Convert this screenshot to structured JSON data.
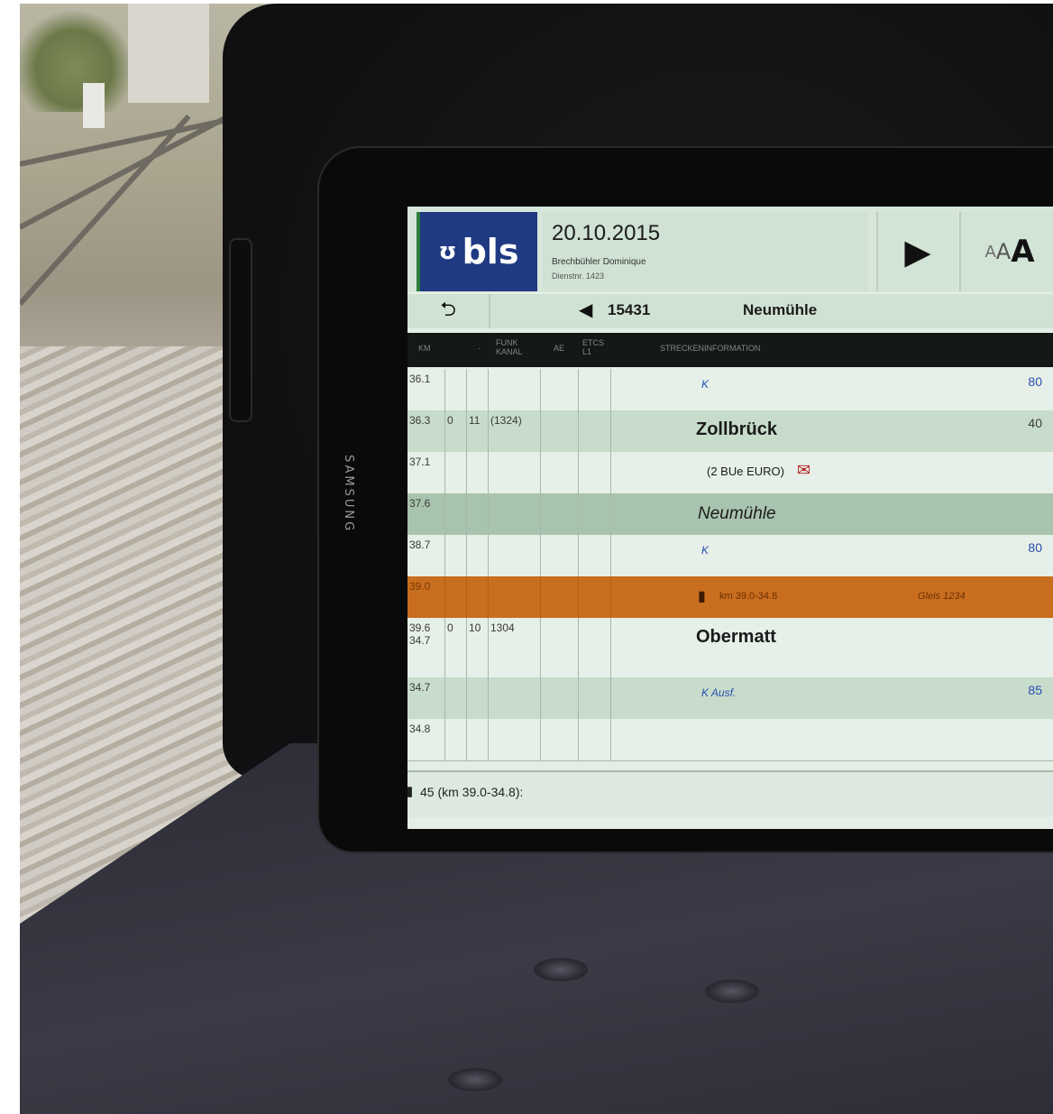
{
  "header": {
    "logo_text": "bls",
    "date": "20.10.2015",
    "driver_name": "Brechbühler Dominique",
    "duty_label": "Dienstnr. 1423"
  },
  "toolbar": {
    "play_icon": "▶",
    "font_size_small": "A",
    "font_size_medium": "A",
    "font_size_large": "A"
  },
  "navigation": {
    "back_icon": "⮌",
    "prev_icon": "◀",
    "train_number": "15431",
    "current_station": "Neumühle"
  },
  "columns": [
    "KM",
    "",
    "·",
    "FUNK KANAL",
    "AE",
    "ETCS L1",
    "STRECKENINFORMATION"
  ],
  "rows": [
    {
      "km": "36.1",
      "c1": "",
      "c2": "",
      "funk": "",
      "info": "K",
      "info_style": "signal",
      "speed": "80",
      "shade": "light"
    },
    {
      "km": "36.3",
      "c1": "0",
      "c2": "11",
      "funk": "(1324)",
      "info": "Zollbrück",
      "info_style": "station",
      "speed": "40",
      "shade": "mid"
    },
    {
      "km": "37.1",
      "c1": "",
      "c2": "",
      "funk": "",
      "info": "(2 BUe EURO)",
      "info_style": "note",
      "speed": "",
      "shade": "light"
    },
    {
      "km": "37.6",
      "c1": "",
      "c2": "",
      "funk": "",
      "info": "Neumühle",
      "info_style": "italic",
      "speed": "",
      "shade": "dark"
    },
    {
      "km": "38.7",
      "c1": "",
      "c2": "",
      "funk": "",
      "info": "K",
      "info_style": "signal",
      "speed": "80",
      "shade": "light"
    },
    {
      "km": "39.0",
      "c1": "",
      "c2": "",
      "funk": "",
      "info": "km 39.0-34.8",
      "info_style": "warning",
      "speed": "",
      "extra": "Gleis 1234",
      "shade": "orange"
    },
    {
      "km": "39.6",
      "km2": "34.7",
      "c1": "0",
      "c2": "10",
      "funk": "1304",
      "info": "Obermatt",
      "info_style": "station",
      "speed": "",
      "shade": "light"
    },
    {
      "km": "34.7",
      "c1": "",
      "c2": "",
      "funk": "",
      "info": "K Ausf.",
      "info_style": "signal",
      "speed": "85",
      "shade": "mid"
    },
    {
      "km": "34.8",
      "c1": "",
      "c2": "",
      "funk": "",
      "info": "",
      "info_style": "note",
      "speed": "",
      "shade": "light"
    }
  ],
  "footer": {
    "message": "45 (km 39.0-34.8):"
  },
  "device": {
    "brand": "SAMSUNG"
  },
  "colors": {
    "bls_blue": "#1f3a82",
    "bls_green": "#2d7c3c",
    "row_light": "#e6efe8",
    "row_mid": "#c7dccb",
    "row_dark": "#a9c4ae",
    "row_orange": "#c96e1e",
    "speed_blue": "#2a4fb0"
  }
}
